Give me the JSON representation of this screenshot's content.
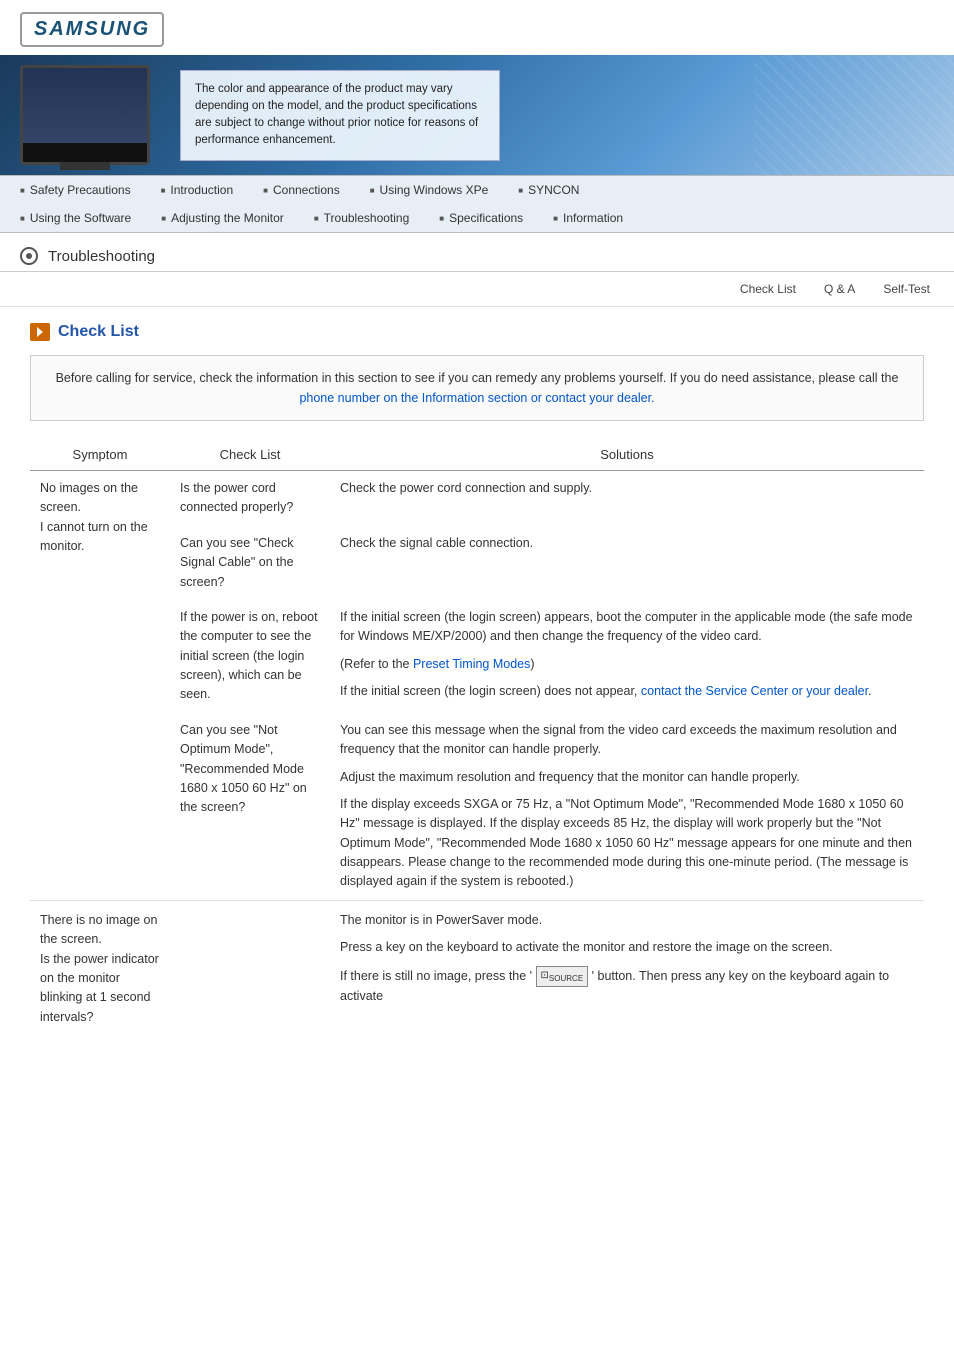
{
  "logo": "SAMSUNG",
  "banner": {
    "text": "The color and appearance of the product may vary depending on the model, and the product specifications are subject to change without prior notice for reasons of performance enhancement."
  },
  "nav": {
    "row1": [
      {
        "label": "Safety Precautions"
      },
      {
        "label": "Introduction"
      },
      {
        "label": "Connections"
      },
      {
        "label": "Using Windows XPe"
      },
      {
        "label": "SYNCON"
      }
    ],
    "row2": [
      {
        "label": "Using the Software"
      },
      {
        "label": "Adjusting the Monitor"
      },
      {
        "label": "Troubleshooting"
      },
      {
        "label": "Specifications"
      },
      {
        "label": "Information"
      }
    ]
  },
  "page_title": "Troubleshooting",
  "sub_nav": [
    {
      "label": "Check List"
    },
    {
      "label": "Q & A"
    },
    {
      "label": "Self-Test"
    }
  ],
  "section_title": "Check List",
  "info_box": {
    "text_before": "Before calling for service, check the information in this section to see if you can remedy any problems yourself. If you do need assistance, please call the ",
    "link1_text": "phone number on the Information section or contact your dealer.",
    "link1_href": "#"
  },
  "table": {
    "headers": [
      "Symptom",
      "Check List",
      "Solutions"
    ],
    "rows": [
      {
        "symptom": "No images on the screen.\nI cannot turn on the monitor.",
        "checks": [
          {
            "check": "Is the power cord connected properly?",
            "solution": "Check the power cord connection and supply."
          },
          {
            "check": "Can you see \"Check Signal Cable\" on the screen?",
            "solution": "Check the signal cable connection."
          },
          {
            "check": "If the power is on, reboot the computer to see the initial screen (the login screen), which can be seen.",
            "solution_parts": [
              "If the initial screen (the login screen) appears, boot the computer in the applicable mode (the safe mode for Windows ME/XP/2000) and then change the frequency of the video card.",
              "(Refer to the [Preset Timing Modes])",
              "If the initial screen (the login screen) does not appear, [contact the Service Center or your dealer]."
            ]
          },
          {
            "check": "Can you see \"Not Optimum Mode\", \"Recommended Mode 1680 x 1050 60 Hz\" on the screen?",
            "solution_parts": [
              "You can see this message when the signal from the video card exceeds the maximum resolution and frequency that the monitor can handle properly.",
              "Adjust the maximum resolution and frequency that the monitor can handle properly.",
              "If the display exceeds SXGA or 75 Hz, a \"Not Optimum Mode\", \"Recommended Mode 1680 x 1050 60 Hz\" message is displayed. If the display exceeds 85 Hz, the display will work properly but the \"Not Optimum Mode\", \"Recommended Mode 1680 x 1050 60 Hz\" message appears for one minute and then disappears. Please change to the recommended mode during this one-minute period. (The message is displayed again if the system is rebooted.)"
            ]
          }
        ]
      },
      {
        "symptom": "There is no image on the screen.\nIs the power indicator on the monitor blinking at 1 second intervals?",
        "checks": [
          {
            "check": "",
            "solution_parts": [
              "The monitor is in PowerSaver mode.",
              "Press a key on the keyboard to activate the monitor and restore the image on the screen.",
              "If there is still no image, press the '[SOURCE]' button. Then press any key on the keyboard again to activate"
            ]
          }
        ]
      }
    ]
  }
}
